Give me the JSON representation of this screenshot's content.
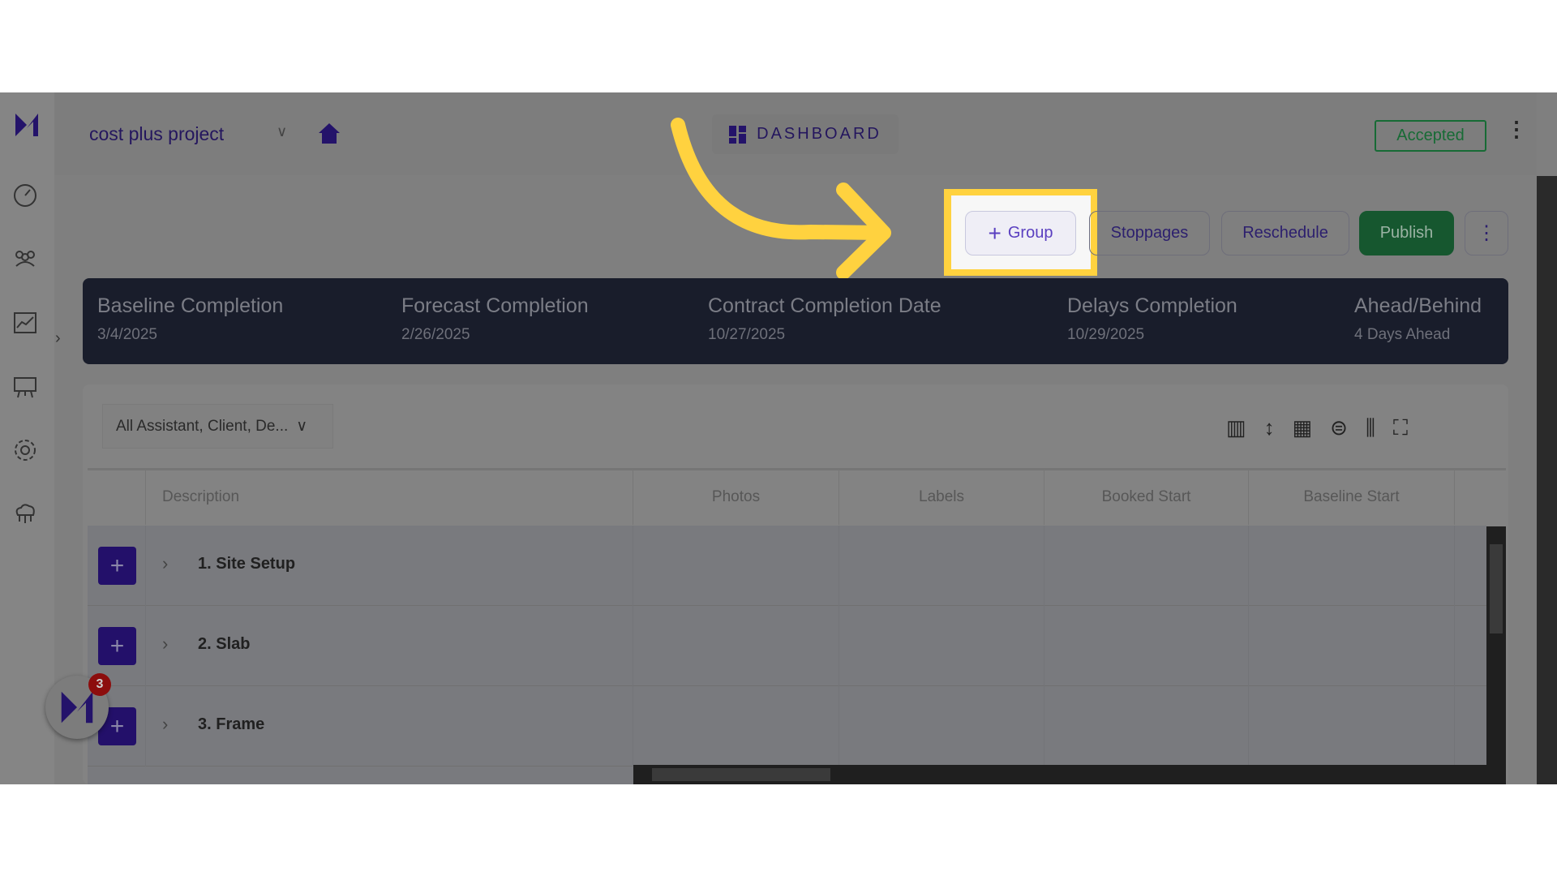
{
  "header": {
    "project_name": "cost plus project",
    "dashboard_label": "DASHBOARD",
    "status": "Accepted"
  },
  "toolbar": {
    "group_label": "Group",
    "stoppages_label": "Stoppages",
    "reschedule_label": "Reschedule",
    "publish_label": "Publish"
  },
  "summary": [
    {
      "title": "Baseline Completion",
      "value": "3/4/2025"
    },
    {
      "title": "Forecast Completion",
      "value": "2/26/2025"
    },
    {
      "title": "Contract Completion Date",
      "value": "10/27/2025"
    },
    {
      "title": "Delays Completion",
      "value": "10/29/2025"
    },
    {
      "title": "Ahead/Behind",
      "value": "4 Days Ahead"
    }
  ],
  "filter": {
    "value": "All Assistant, Client, De..."
  },
  "table": {
    "columns": [
      "Description",
      "Photos",
      "Labels",
      "Booked Start",
      "Baseline Start"
    ],
    "rows": [
      {
        "label": "1. Site Setup"
      },
      {
        "label": "2. Slab"
      },
      {
        "label": "3. Frame"
      }
    ]
  },
  "notification": {
    "count": "3"
  },
  "colors": {
    "brand": "#23106a",
    "publish": "#16572f",
    "highlight": "#ffd23f"
  }
}
